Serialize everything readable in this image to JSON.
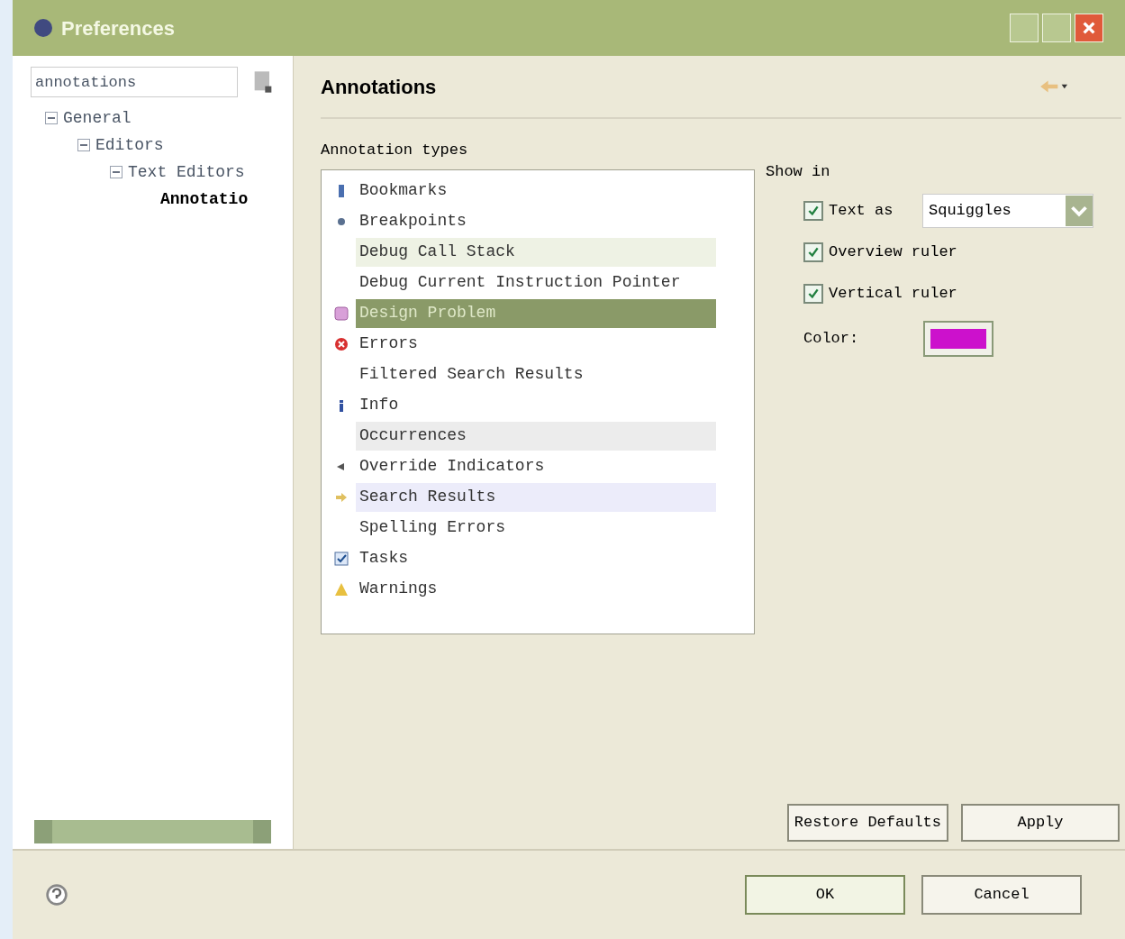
{
  "window": {
    "title": "Preferences"
  },
  "filter": {
    "value": "annotations"
  },
  "tree": [
    {
      "label": "General",
      "expanded": true,
      "selected": false,
      "children": [
        {
          "label": "Editors",
          "expanded": true,
          "selected": false,
          "children": [
            {
              "label": "Text Editors",
              "expanded": true,
              "selected": false,
              "children": [
                {
                  "label": "Annotatio",
                  "selected": true
                }
              ]
            }
          ]
        }
      ]
    }
  ],
  "page": {
    "title": "Annotations"
  },
  "annotation_types": {
    "label": "Annotation types",
    "items": [
      {
        "label": "Bookmarks",
        "kind": "bookmark",
        "selected": false
      },
      {
        "label": "Breakpoints",
        "kind": "breakpoint",
        "selected": false
      },
      {
        "label": "Debug Call Stack",
        "kind": "plain",
        "selected": false,
        "color": "#eef2e4"
      },
      {
        "label": "Debug Current Instruction Pointer",
        "kind": "plain",
        "selected": false
      },
      {
        "label": "Design Problem",
        "kind": "problem",
        "selected": true
      },
      {
        "label": "Errors",
        "kind": "error",
        "selected": false
      },
      {
        "label": "Filtered Search Results",
        "kind": "plain",
        "selected": false
      },
      {
        "label": "Info",
        "kind": "info",
        "selected": false
      },
      {
        "label": "Occurrences",
        "kind": "plain",
        "selected": false,
        "color": "#ececec"
      },
      {
        "label": "Override Indicators",
        "kind": "override",
        "selected": false
      },
      {
        "label": "Search Results",
        "kind": "search",
        "selected": false,
        "color": "#ececfa"
      },
      {
        "label": "Spelling Errors",
        "kind": "plain",
        "selected": false
      },
      {
        "label": "Tasks",
        "kind": "task",
        "selected": false
      },
      {
        "label": "Warnings",
        "kind": "warning",
        "selected": false
      }
    ]
  },
  "show_in": {
    "label": "Show in",
    "options": [
      {
        "label": "Text as",
        "checked": true,
        "kind": "dropdown",
        "value": "Squiggles"
      },
      {
        "label": "Overview ruler",
        "checked": true,
        "kind": "plain"
      },
      {
        "label": "Vertical ruler",
        "checked": true,
        "kind": "plain"
      }
    ],
    "color_label": "Color:",
    "color": "#cc11cc"
  },
  "buttons": {
    "restore": "Restore Defaults",
    "apply": "Apply",
    "ok": "OK",
    "cancel": "Cancel"
  }
}
